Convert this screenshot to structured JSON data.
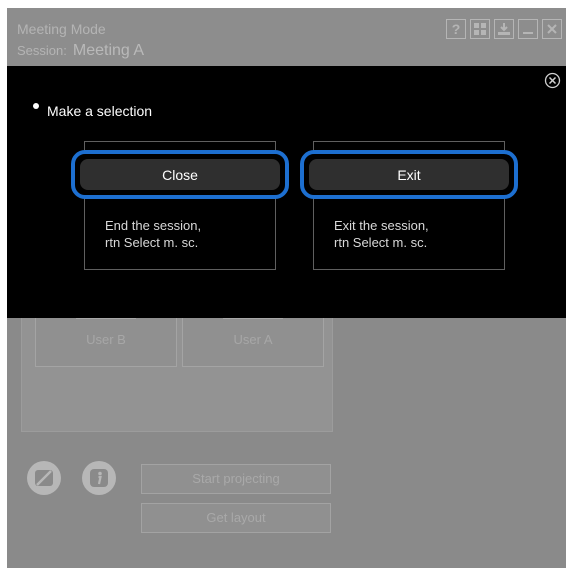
{
  "window": {
    "title": "Meeting Mode",
    "session_label": "Session:",
    "session_name": "Meeting A",
    "toolbar_icons": [
      "help-icon",
      "grid-layout-icon",
      "download-icon",
      "minimize-icon",
      "close-icon"
    ]
  },
  "background": {
    "users": [
      "User B",
      "User A"
    ],
    "start_projecting_label": "Start projecting",
    "get_layout_label": "Get layout"
  },
  "dialog": {
    "prompt": "Make a selection",
    "options": [
      {
        "label": "Close",
        "description_line1": "End the session,",
        "description_line2": "rtn Select m. sc."
      },
      {
        "label": "Exit",
        "description_line1": "Exit the session,",
        "description_line2": "rtn Select m. sc."
      }
    ],
    "accent_color": "#1d6fd0"
  }
}
